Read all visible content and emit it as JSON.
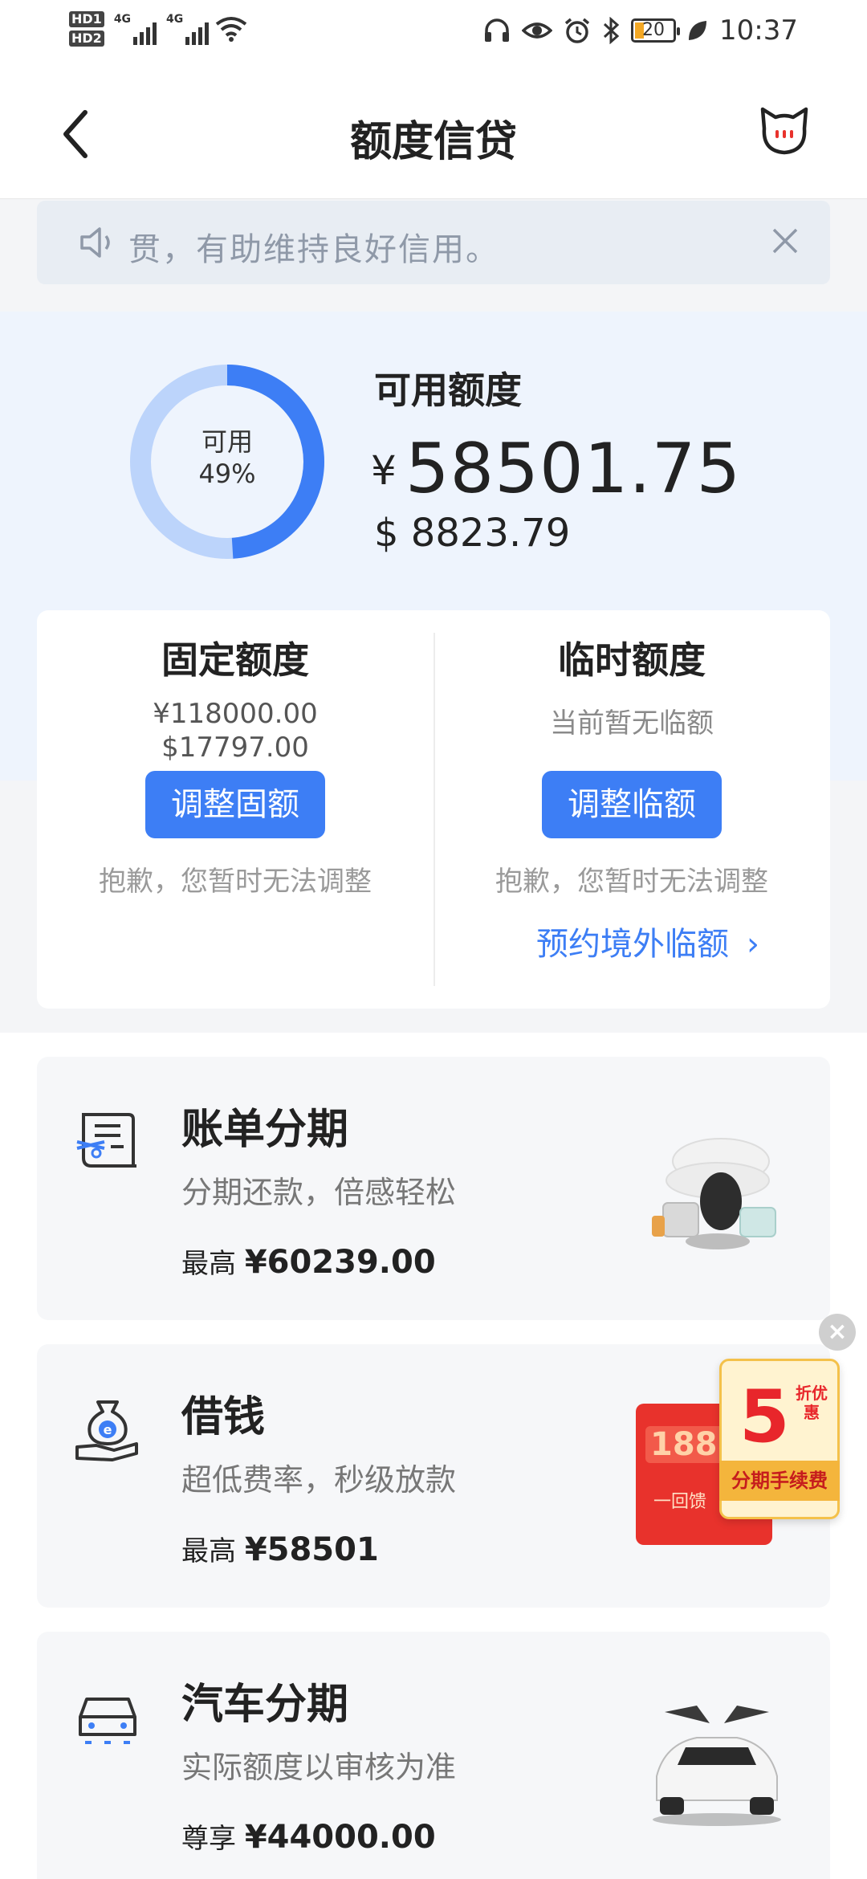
{
  "status_bar": {
    "hd1": "HD",
    "hd1_sub": "1",
    "hd2": "HD",
    "hd2_sub": "2",
    "net1": "4G",
    "net2": "4G",
    "battery": "20",
    "time": "10:37"
  },
  "nav": {
    "title": "额度信贷"
  },
  "notice": {
    "text": "贯，有助维持良好信用。"
  },
  "credit": {
    "ring_label": "可用",
    "ring_percent": "49%",
    "ring_fraction": 0.49,
    "available_title": "可用额度",
    "cny_symbol": "¥",
    "available_cny": "58501.75",
    "available_usd": "$ 8823.79"
  },
  "fixed_quota": {
    "title": "固定额度",
    "cny": "¥118000.00",
    "usd": "$17797.00",
    "button": "调整固额",
    "note": "抱歉，您暂时无法调整"
  },
  "temp_quota": {
    "title": "临时额度",
    "status": "当前暂无临额",
    "button": "调整临额",
    "note": "抱歉，您暂时无法调整",
    "link": "预约境外临额",
    "link_chevron": "›"
  },
  "services": [
    {
      "title": "账单分期",
      "desc": "分期还款，倍感轻松",
      "amount_prefix": "最高",
      "amount": "¥60239.00"
    },
    {
      "title": "借钱",
      "desc": "超低费率，秒级放款",
      "amount_prefix": "最高",
      "amount": "¥58501"
    },
    {
      "title": "汽车分期",
      "desc": "实际额度以审核为准",
      "amount_prefix": "尊享",
      "amount": "¥44000.00"
    }
  ],
  "promo": {
    "close": "×",
    "big": "5",
    "side": "折优惠",
    "band": "分期手续费",
    "redbox_num": "1888",
    "redbox_text": "一回馈"
  },
  "colors": {
    "accent": "#3d7ef5",
    "ring_light": "#bcd4fb",
    "panel": "#eef4fd"
  }
}
